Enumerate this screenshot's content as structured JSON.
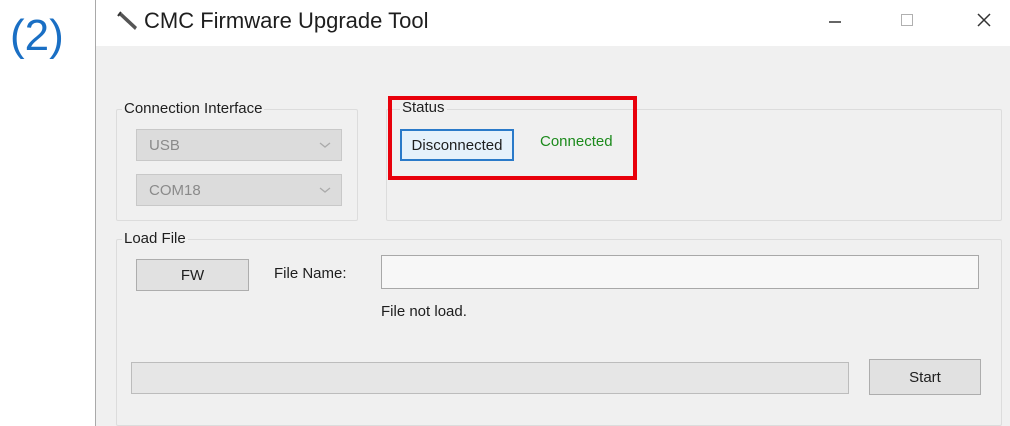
{
  "annotation": {
    "step_label": "(2)"
  },
  "window": {
    "title": "CMC Firmware Upgrade Tool",
    "icon": "wrench-icon",
    "controls": {
      "minimize": "minimize-icon",
      "maximize": "maximize-icon",
      "close": "close-icon"
    }
  },
  "connection_interface": {
    "title": "Connection Interface",
    "interface_select": {
      "value": "USB"
    },
    "port_select": {
      "value": "COM18"
    }
  },
  "status": {
    "title": "Status",
    "disconnect_button_label": "Disconnected",
    "connected_text": "Connected",
    "connected_color": "#1c8a1c",
    "highlight_color": "#e8000b"
  },
  "load_file": {
    "title": "Load File",
    "fw_button_label": "FW",
    "file_name_label": "File Name:",
    "file_name_value": "",
    "message": "File not load."
  },
  "progress": {
    "value": 0
  },
  "start_button_label": "Start"
}
